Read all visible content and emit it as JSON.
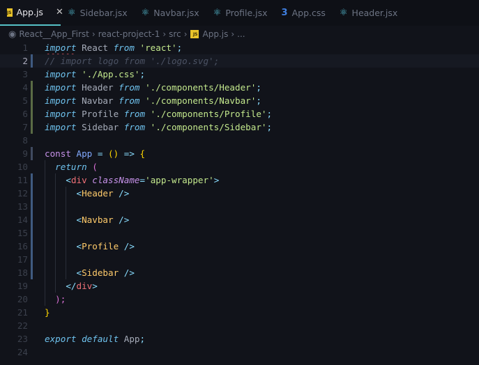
{
  "tabs": [
    {
      "label": "App.js",
      "icon": "js-icon",
      "active": true
    },
    {
      "label": "Sidebar.jsx",
      "icon": "react-icon"
    },
    {
      "label": "Navbar.jsx",
      "icon": "react-icon"
    },
    {
      "label": "Profile.jsx",
      "icon": "react-icon"
    },
    {
      "label": "App.css",
      "icon": "css-icon"
    },
    {
      "label": "Header.jsx",
      "icon": "react-icon"
    }
  ],
  "close_glyph": "✕",
  "breadcrumb": [
    "React__App_First",
    "react-project-1",
    "src",
    "App.js",
    "..."
  ],
  "current_line": 2,
  "lines": [
    [
      [
        "import",
        "kw sq"
      ],
      [
        " React ",
        "id"
      ],
      [
        "from",
        "kw"
      ],
      [
        " 'react'",
        "str"
      ],
      [
        ";",
        "op"
      ]
    ],
    [
      [
        "// import logo from './logo.svg';",
        "cm"
      ]
    ],
    [
      [
        "import",
        "kw"
      ],
      [
        " './App.css'",
        "str"
      ],
      [
        ";",
        "op"
      ]
    ],
    [
      [
        "import",
        "kw"
      ],
      [
        " Header ",
        "id"
      ],
      [
        "from",
        "kw"
      ],
      [
        " './components/Header'",
        "str"
      ],
      [
        ";",
        "op"
      ]
    ],
    [
      [
        "import",
        "kw"
      ],
      [
        " Navbar ",
        "id"
      ],
      [
        "from",
        "kw"
      ],
      [
        " './components/Navbar'",
        "str"
      ],
      [
        ";",
        "op"
      ]
    ],
    [
      [
        "import",
        "kw"
      ],
      [
        " Profile ",
        "id"
      ],
      [
        "from",
        "kw"
      ],
      [
        " './components/Profile'",
        "str"
      ],
      [
        ";",
        "op"
      ]
    ],
    [
      [
        "import",
        "kw"
      ],
      [
        " Sidebar ",
        "id"
      ],
      [
        "from",
        "kw"
      ],
      [
        " './components/Sidebar'",
        "str"
      ],
      [
        ";",
        "op"
      ]
    ],
    [],
    [
      [
        "const",
        "cn"
      ],
      [
        " App ",
        "fn"
      ],
      [
        "=",
        "op"
      ],
      [
        " () ",
        "br"
      ],
      [
        "=>",
        "op"
      ],
      [
        " {",
        "br"
      ]
    ],
    [
      [
        "  "
      ],
      [
        "return",
        "kw"
      ],
      [
        " (",
        "pa"
      ]
    ],
    [
      [
        "    "
      ],
      [
        "<",
        "pn"
      ],
      [
        "div",
        "el"
      ],
      [
        " className",
        "at"
      ],
      [
        "=",
        "op"
      ],
      [
        "'app-wrapper'",
        "str"
      ],
      [
        ">",
        "pn"
      ]
    ],
    [
      [
        "      "
      ],
      [
        "<",
        "pn"
      ],
      [
        "Header",
        "tg"
      ],
      [
        " />",
        "pn"
      ]
    ],
    [],
    [
      [
        "      "
      ],
      [
        "<",
        "pn"
      ],
      [
        "Navbar",
        "tg"
      ],
      [
        " />",
        "pn"
      ]
    ],
    [],
    [
      [
        "      "
      ],
      [
        "<",
        "pn"
      ],
      [
        "Profile",
        "tg"
      ],
      [
        " />",
        "pn"
      ]
    ],
    [],
    [
      [
        "      "
      ],
      [
        "<",
        "pn"
      ],
      [
        "Sidebar",
        "tg"
      ],
      [
        " />",
        "pn"
      ]
    ],
    [
      [
        "    "
      ],
      [
        "</",
        "pn"
      ],
      [
        "div",
        "el"
      ],
      [
        ">",
        "pn"
      ]
    ],
    [
      [
        "  "
      ],
      [
        ");",
        "pa"
      ]
    ],
    [
      [
        "}",
        "br"
      ]
    ],
    [],
    [
      [
        "export",
        "kw"
      ],
      [
        " ",
        "id"
      ],
      [
        "default",
        "kw"
      ],
      [
        " App",
        "id"
      ],
      [
        ";",
        "op"
      ]
    ],
    []
  ],
  "gutter": {
    "2": "#3f5a80",
    "4": "#5a6b45",
    "5": "#5a6b45",
    "6": "#5a6b45",
    "7": "#5a6b45",
    "9": "#3f4a60",
    "11": "#3f5a80",
    "12": "#3f5a80",
    "13": "#3f5a80",
    "14": "#3f5a80",
    "15": "#3f5a80",
    "16": "#3f5a80",
    "17": "#3f5a80",
    "18": "#3f5a80"
  }
}
